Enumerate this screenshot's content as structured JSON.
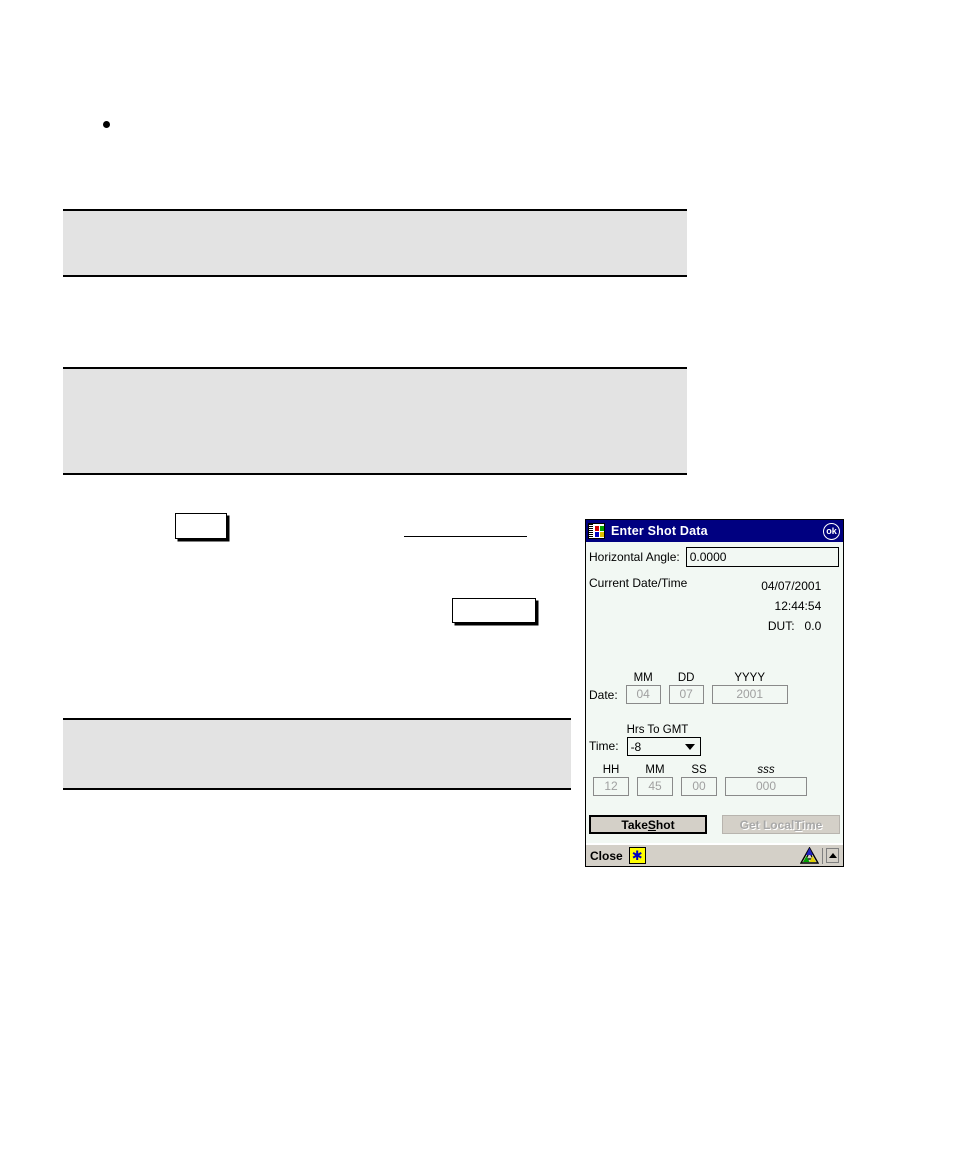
{
  "document": {
    "bullet_marker": "•",
    "redacted_blocks": 3,
    "empty_boxes": 2,
    "rules": 1
  },
  "dialog": {
    "title": "Enter Shot Data",
    "title_icon": "book-icon",
    "ok_label": "ok",
    "horizontal_angle": {
      "label": "Horizontal Angle:",
      "value": "0.0000"
    },
    "current_datetime": {
      "label": "Current Date/Time",
      "date": "04/07/2001",
      "time": "12:44:54",
      "dut": "DUT:   0.0"
    },
    "date_section": {
      "label": "Date:",
      "fields": [
        {
          "caption": "MM",
          "value": "04",
          "disabled": true
        },
        {
          "caption": "DD",
          "value": "07",
          "disabled": true
        },
        {
          "caption": "YYYY",
          "value": "2001",
          "disabled": true
        }
      ]
    },
    "time_section": {
      "label": "Time:",
      "gmt_caption": "Hrs To GMT",
      "gmt_value": "-8",
      "gmt_options": [
        "-8"
      ],
      "fields": [
        {
          "caption": "HH",
          "value": "12",
          "disabled": true
        },
        {
          "caption": "MM",
          "value": "45",
          "disabled": true
        },
        {
          "caption": "SS",
          "value": "00",
          "disabled": true
        },
        {
          "caption": "sss",
          "value": "000",
          "disabled": true
        }
      ]
    },
    "buttons": {
      "take_shot": {
        "pre": "Take ",
        "accel": "S",
        "post": "hot",
        "disabled": false
      },
      "get_local_time": {
        "pre": "Get Local ",
        "accel": "T",
        "post": "ime",
        "disabled": true
      }
    },
    "taskbar": {
      "close_label": "Close",
      "star_icon": "asterisk-icon",
      "status_icon": "survey-triangle-icon",
      "up_arrow": "up-arrow-icon"
    },
    "colors": {
      "titlebar": "#000080",
      "client_bg": "#f2f8f3",
      "taskbar_bg": "#d4d0c8",
      "disabled_text": "#a0a0a0"
    }
  }
}
